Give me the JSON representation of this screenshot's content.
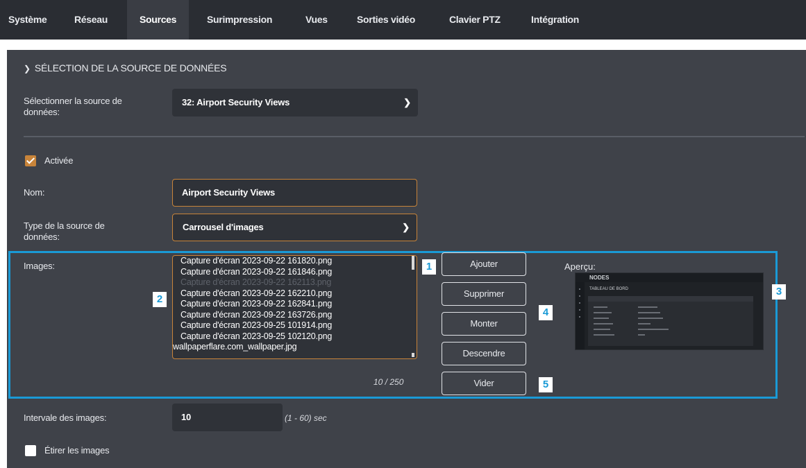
{
  "tabs": [
    {
      "label": "Système",
      "active": false
    },
    {
      "label": "Réseau",
      "active": false
    },
    {
      "label": "Sources",
      "active": true
    },
    {
      "label": "Surimpression",
      "active": false
    },
    {
      "label": "Vues",
      "active": false
    },
    {
      "label": "Sorties vidéo",
      "active": false
    },
    {
      "label": "Clavier PTZ",
      "active": false
    },
    {
      "label": "Intégration",
      "active": false
    }
  ],
  "section": {
    "title": "SÉLECTION DE LA SOURCE DE DONNÉES",
    "chevron_icon": "chevron-down-icon"
  },
  "source_select": {
    "label_line1": "Sélectionner la source de",
    "label_line2": "données:",
    "value": "32: Airport Security Views"
  },
  "enabled": {
    "label": "Activée",
    "checked": true
  },
  "name": {
    "label": "Nom:",
    "value": "Airport Security Views"
  },
  "source_type": {
    "label_line1": "Type de la source de",
    "label_line2": "données:",
    "value": "Carrousel d'images"
  },
  "images": {
    "label": "Images:",
    "items": [
      "Capture d'écran 2023-09-22 161820.png",
      "Capture d'écran 2023-09-22 161846.png",
      "Capture d'écran 2023-09-22 162113.png",
      "Capture d'écran 2023-09-22 162210.png",
      "Capture d'écran 2023-09-22 162841.png",
      "Capture d'écran 2023-09-22 163726.png",
      "Capture d'écran 2023-09-25 101914.png",
      "Capture d'écran 2023-09-25 102120.png",
      "wallpaperflare.com_wallpaper.jpg"
    ],
    "dimmed_index": 2,
    "count": "10 / 250"
  },
  "buttons": {
    "add": "Ajouter",
    "delete": "Supprimer",
    "up": "Monter",
    "down": "Descendre",
    "clear": "Vider"
  },
  "preview": {
    "label": "Aperçu:",
    "logo": "NODES",
    "title": "TABLEAU DE BORD"
  },
  "badges": [
    "1",
    "2",
    "3",
    "4",
    "5"
  ],
  "interval": {
    "label": "Intervale des images:",
    "value": "10",
    "hint": "(1 - 60) sec"
  },
  "stretch": {
    "label": "Étirer les images",
    "checked": false
  },
  "colors": {
    "accent": "#c8843a",
    "highlight": "#1a9ad6",
    "panel": "#3f4249",
    "tabbar": "#2a2d33"
  }
}
